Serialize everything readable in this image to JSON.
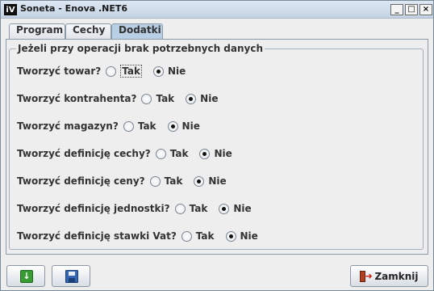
{
  "window": {
    "title": "Soneta - Enova .NET6",
    "app_icon": "iV",
    "controls": {
      "minimize": "_",
      "maximize": "□",
      "close": "×"
    }
  },
  "tabs": [
    {
      "label": "Program",
      "selected": false
    },
    {
      "label": "Cechy",
      "selected": false
    },
    {
      "label": "Dodatki",
      "selected": true
    }
  ],
  "group": {
    "title": "Jeżeli przy operacji brak potrzebnych danych",
    "yes_label": "Tak",
    "no_label": "Nie",
    "questions": [
      {
        "label": "Tworzyć towar?",
        "selected": "Nie"
      },
      {
        "label": "Tworzyć kontrahenta?",
        "selected": "Nie"
      },
      {
        "label": "Tworzyć magazyn?",
        "selected": "Nie"
      },
      {
        "label": "Tworzyć definicję cechy?",
        "selected": "Nie"
      },
      {
        "label": "Tworzyć definicję ceny?",
        "selected": "Nie"
      },
      {
        "label": "Tworzyć definicję jednostki?",
        "selected": "Nie"
      },
      {
        "label": "Tworzyć definicję stawki Vat?",
        "selected": "Nie"
      }
    ]
  },
  "footer": {
    "download_icon": "download-icon",
    "save_icon": "floppy-disk-icon",
    "close_label": "Zamknij",
    "close_icon": "exit-door-icon"
  }
}
